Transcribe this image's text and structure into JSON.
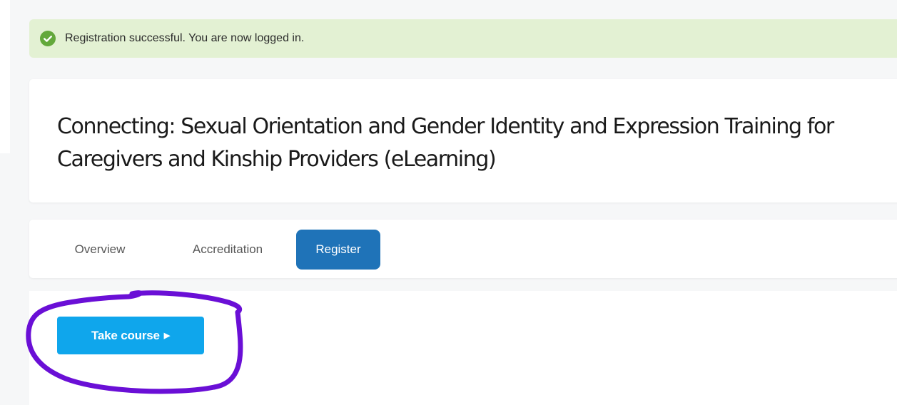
{
  "alert": {
    "message": "Registration successful. You are now logged in.",
    "icon": "check-circle-icon",
    "color": "#e3f1d3",
    "icon_color": "#63a83b"
  },
  "course": {
    "title": "Connecting: Sexual Orientation and Gender Identity and Expression Training for Caregivers and Kinship Providers (eLearning)"
  },
  "tabs": [
    {
      "label": "Overview",
      "active": false
    },
    {
      "label": "Accreditation",
      "active": false
    },
    {
      "label": "Register",
      "active": true
    }
  ],
  "actions": {
    "take_course_label": "Take course",
    "take_course_icon": "caret-right-icon"
  },
  "colors": {
    "accent": "#1f73b8",
    "primary_button": "#0fa6ec",
    "annotation": "#6a0fd6"
  }
}
